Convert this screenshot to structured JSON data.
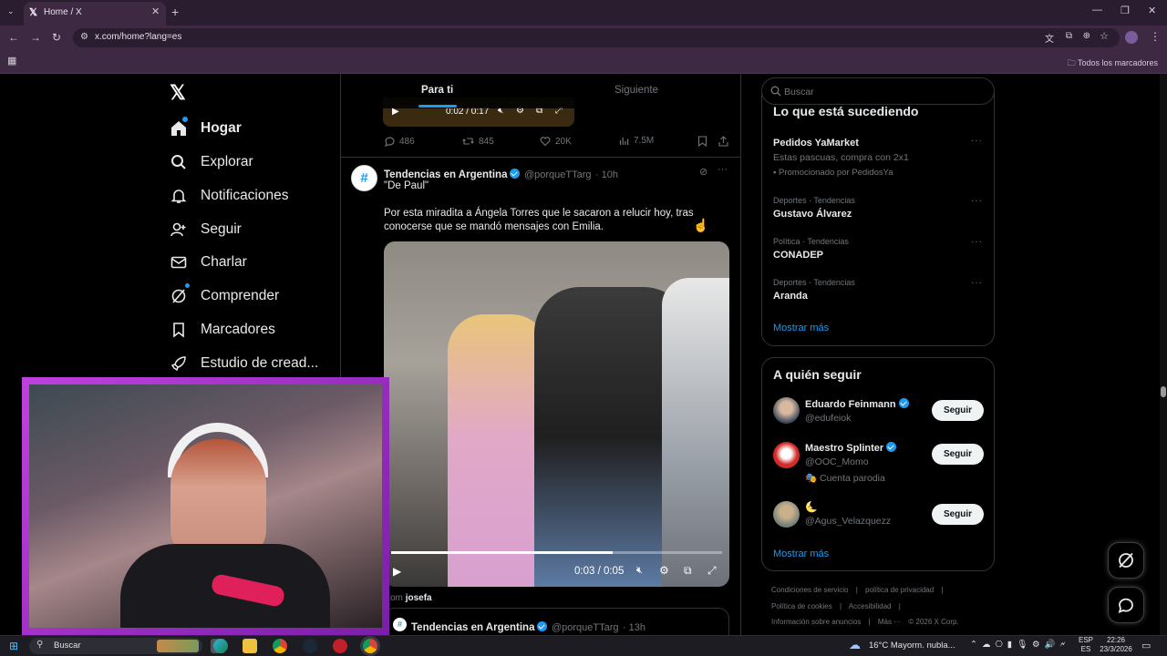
{
  "browser": {
    "tab_title": "Home / X",
    "tab_favicon": "x-logo-icon",
    "url": "x.com/home?lang=es",
    "bookmarks_folder": "Todos los marcadores"
  },
  "sidebar": {
    "items": [
      {
        "label": "Hogar",
        "icon": "home-icon"
      },
      {
        "label": "Explorar",
        "icon": "search-icon"
      },
      {
        "label": "Notificaciones",
        "icon": "bell-icon"
      },
      {
        "label": "Seguir",
        "icon": "person-add-icon"
      },
      {
        "label": "Charlar",
        "icon": "mail-icon"
      },
      {
        "label": "Comprender",
        "icon": "grok-icon"
      },
      {
        "label": "Marcadores",
        "icon": "bookmark-icon"
      },
      {
        "label": "Estudio de cread..."
      }
    ]
  },
  "feed": {
    "tabs": [
      "Para ti",
      "Siguiente"
    ],
    "top_video_time": "0:02 / 0:17",
    "top_actions": {
      "replies": "486",
      "retweets": "845",
      "likes": "20K",
      "views": "7.5M"
    },
    "tweet": {
      "name": "Tendencias en Argentina",
      "handle": "@porqueTTarg",
      "time": "· 10h",
      "quote": "\"De Paul\"",
      "text_line1": "Por esta miradita a Ángela Torres que le sacaron a relucir hoy, tras",
      "text_line2": "conocerse que se mandó mensajes con Emilia.",
      "video_time": "0:03 / 0:05",
      "video_progress": 0.67,
      "from_label": "om",
      "from_user": "josefa"
    },
    "next_tweet": {
      "name": "Tendencias en Argentina",
      "handle": "@porqueTTarg",
      "time": "· 13h"
    }
  },
  "right": {
    "search_placeholder": "Buscar",
    "trends_title": "Lo que está sucediendo",
    "promo": {
      "name": "Pedidos YaMarket",
      "desc": "Estas pascuas, compra con 2x1",
      "promoted": "Promocionado por PedidosYa"
    },
    "trends": [
      {
        "category": "Deportes · Tendencias",
        "name": "Gustavo Álvarez"
      },
      {
        "category": "Política · Tendencias",
        "name": "CONADEP"
      },
      {
        "category": "Deportes · Tendencias",
        "name": "Aranda"
      }
    ],
    "show_more": "Mostrar más",
    "follow_title": "A quién seguir",
    "follow": [
      {
        "name": "Eduardo Feinmann",
        "handle": "@edufeiok",
        "button": "Seguir"
      },
      {
        "name": "Maestro Splinter",
        "handle": "@OOC_Momo",
        "extra": "Cuenta parodia",
        "button": "Seguir"
      },
      {
        "name": "🌜",
        "handle": "@Agus_Velazquezz",
        "button": "Seguir"
      }
    ],
    "follow_more": "Mostrar más",
    "footer": {
      "l1a": "Condiciones de servicio",
      "l1b": "política de privacidad",
      "l2a": "Política de cookies",
      "l2b": "Accesibilidad",
      "l3a": "Información sobre anuncios",
      "l3b": "Más ···",
      "l3c": "© 2026 X Corp."
    }
  },
  "taskbar": {
    "search": "Buscar",
    "weather": "16°C  Mayorm. nubla...",
    "lang1": "ESP",
    "lang2": "ES",
    "time": "22:26",
    "date": "23/3/2026"
  },
  "colors": {
    "accent": "#1d9bf0",
    "stream_border": "#a020c8",
    "chrome": "#3d2a42"
  }
}
